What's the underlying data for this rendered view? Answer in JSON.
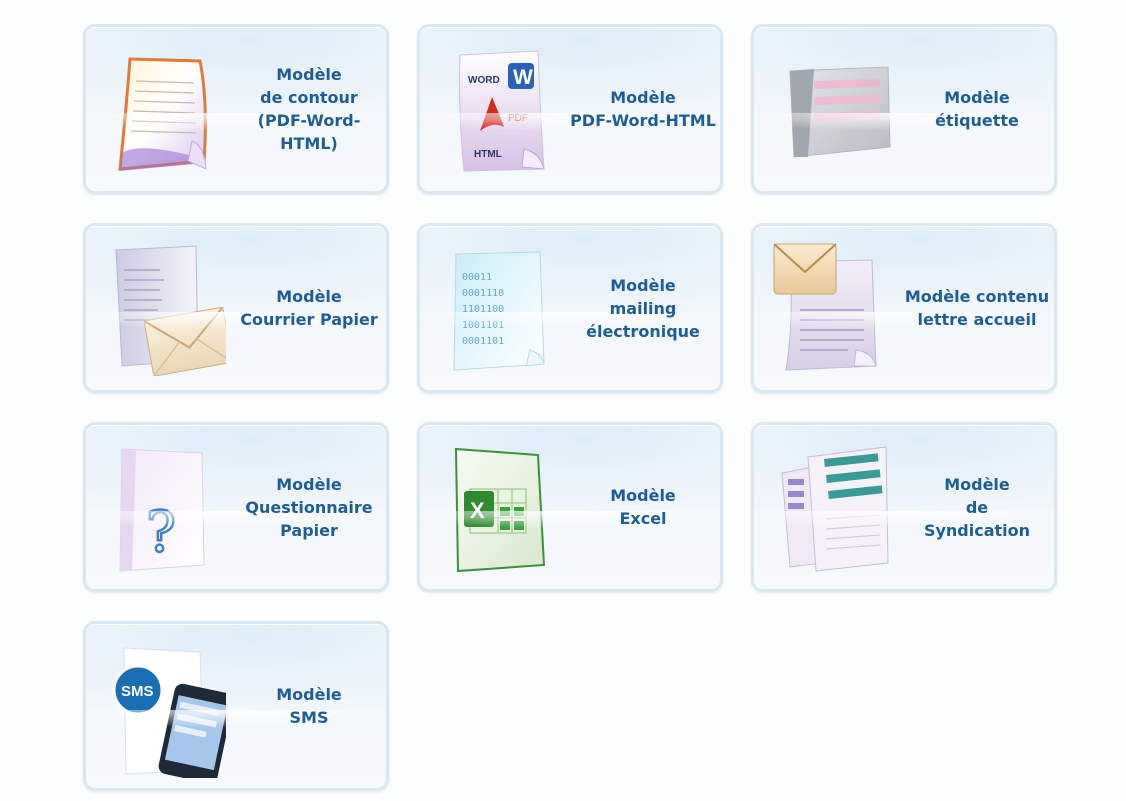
{
  "tiles": [
    {
      "label": "Modèle\nde contour\n(PDF-Word-\nHTML)",
      "icon": "contour-document-icon"
    },
    {
      "label": "Modèle\nPDF-Word-HTML",
      "icon": "pdf-word-html-icon"
    },
    {
      "label": "Modèle\nétiquette",
      "icon": "label-sheet-icon"
    },
    {
      "label": "Modèle\nCourrier Papier",
      "icon": "paper-letter-envelope-icon"
    },
    {
      "label": "Modèle\nmailing\nélectronique",
      "icon": "email-binary-document-icon"
    },
    {
      "label": "Modèle contenu\nlettre accueil",
      "icon": "welcome-letter-envelope-icon"
    },
    {
      "label": "Modèle\nQuestionnaire\nPapier",
      "icon": "question-mark-document-icon"
    },
    {
      "label": "Modèle\nExcel",
      "icon": "excel-icon"
    },
    {
      "label": "Modèle\nde\nSyndication",
      "icon": "syndication-documents-icon"
    },
    {
      "label": "Modèle\nSMS",
      "icon": "sms-phone-icon"
    }
  ],
  "icon_text": {
    "word": "WORD",
    "word_letter": "W",
    "pdf": "PDF",
    "html": "HTML",
    "binary": [
      "00011",
      "0001110",
      "1101100",
      "1001101",
      "0001101"
    ],
    "excel_letter": "X",
    "question": "?",
    "sms": "SMS"
  },
  "colors": {
    "label": "#1f5d95",
    "tile_border": "#dbe7ef",
    "pdf_red": "#d42a1c",
    "excel_green": "#2e8b2e",
    "sms_blue": "#1a6fb4",
    "syndication_teal": "#3a9a96"
  }
}
